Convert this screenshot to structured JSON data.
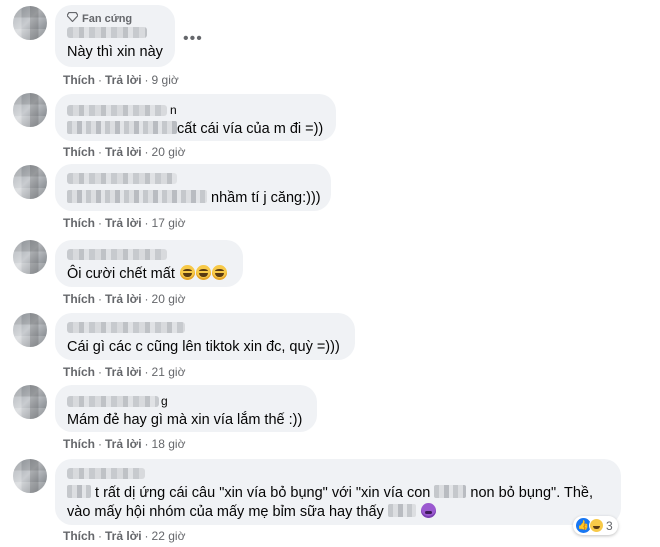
{
  "comments": [
    {
      "badge": "Fan cứng",
      "text": "Này thì xin này",
      "like": "Thích",
      "reply": "Trả lời",
      "time": "9 giờ",
      "more": "•••"
    },
    {
      "text": "cất cái vía của m đi =))",
      "like": "Thích",
      "reply": "Trả lời",
      "time": "20 giờ"
    },
    {
      "text": "nhầm tí j căng:)))",
      "like": "Thích",
      "reply": "Trả lời",
      "time": "17 giờ"
    },
    {
      "text": "Ôi cười chết mất",
      "like": "Thích",
      "reply": "Trả lời",
      "time": "20 giờ"
    },
    {
      "text": "Cái gì các c cũng lên tiktok xin đc, quỳ =)))",
      "like": "Thích",
      "reply": "Trả lời",
      "time": "21 giờ"
    },
    {
      "name_suffix": "g",
      "text": "Mám đẻ hay gì mà xin vía lắm thế :))",
      "like": "Thích",
      "reply": "Trả lời",
      "time": "18 giờ"
    },
    {
      "line1_a": "t rất dị ứng cái câu \"xin vía bỏ bụng\" với \"xin vía con",
      "line1_b": "non bỏ bụng\". Thề,",
      "line2": "vào mấy hội nhóm của mấy mẹ bỉm sữa hay thấy",
      "like": "Thích",
      "reply": "Trả lời",
      "time": "22 giờ",
      "reaction_count": "3"
    }
  ],
  "name_fragment_2": "n",
  "colors": {
    "bubble": "#f0f2f5",
    "meta": "#65676b",
    "text": "#050505"
  }
}
